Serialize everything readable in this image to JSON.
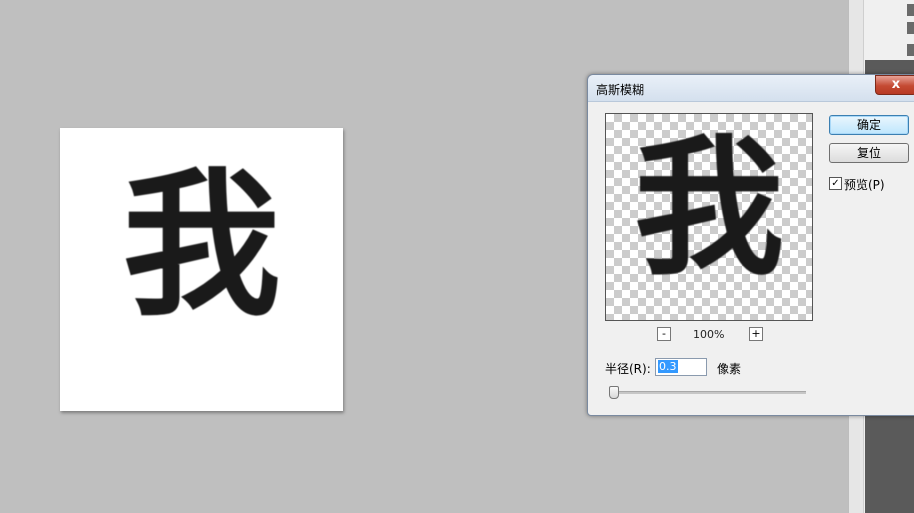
{
  "canvas": {
    "glyph": "我"
  },
  "dialog": {
    "title": "高斯模糊",
    "close_label": "x",
    "preview_glyph": "我",
    "zoom": {
      "minus": "-",
      "plus": "+",
      "level": "100%"
    },
    "ok_label": "确定",
    "reset_label": "复位",
    "preview_checkbox": {
      "label": "预览(P)",
      "checked": true,
      "mark": "✓"
    },
    "radius": {
      "label": "半径(R):",
      "value": "0.3",
      "unit": "像素"
    },
    "slider": {
      "value": 0.3
    }
  }
}
